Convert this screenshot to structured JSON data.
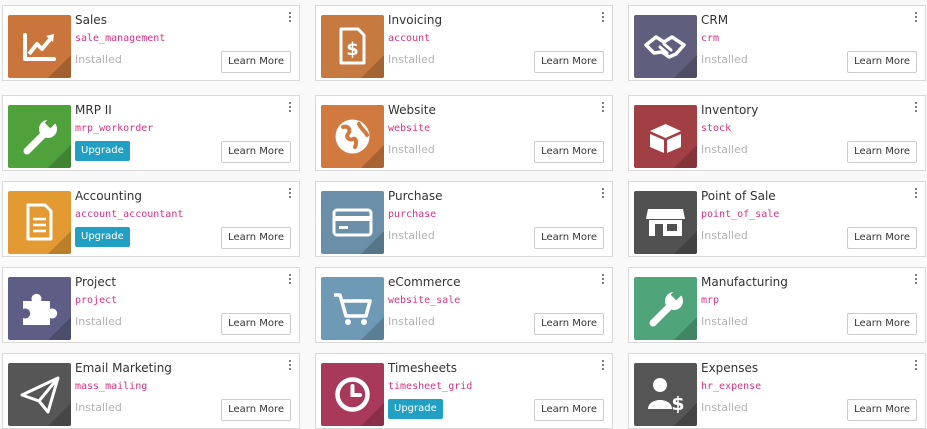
{
  "apps": [
    {
      "name": "Sales",
      "technical": "sale_management",
      "state": "installed",
      "status": "Installed",
      "learn": "Learn More",
      "icon": "sales-chart-icon",
      "color": "#c9753c"
    },
    {
      "name": "Invoicing",
      "technical": "account",
      "state": "installed",
      "status": "Installed",
      "learn": "Learn More",
      "icon": "invoice-dollar-icon",
      "color": "#c77a3f"
    },
    {
      "name": "CRM",
      "technical": "crm",
      "state": "installed",
      "status": "Installed",
      "learn": "Learn More",
      "icon": "handshake-icon",
      "color": "#5f5e7d"
    },
    {
      "name": "MRP II",
      "technical": "mrp_workorder",
      "state": "upgrade",
      "button": "Upgrade",
      "learn": "Learn More",
      "icon": "wrench-icon",
      "color": "#4ea13b"
    },
    {
      "name": "Website",
      "technical": "website",
      "state": "installed",
      "status": "Installed",
      "learn": "Learn More",
      "icon": "globe-icon",
      "color": "#d07a40"
    },
    {
      "name": "Inventory",
      "technical": "stock",
      "state": "installed",
      "status": "Installed",
      "learn": "Learn More",
      "icon": "package-box-icon",
      "color": "#a23f45"
    },
    {
      "name": "Accounting",
      "technical": "account_accountant",
      "state": "upgrade",
      "button": "Upgrade",
      "learn": "Learn More",
      "icon": "document-icon",
      "color": "#e49a32"
    },
    {
      "name": "Purchase",
      "technical": "purchase",
      "state": "installed",
      "status": "Installed",
      "learn": "Learn More",
      "icon": "credit-card-icon",
      "color": "#6b8fa8"
    },
    {
      "name": "Point of Sale",
      "technical": "point_of_sale",
      "state": "installed",
      "status": "Installed",
      "learn": "Learn More",
      "icon": "shop-icon",
      "color": "#515151"
    },
    {
      "name": "Project",
      "technical": "project",
      "state": "installed",
      "status": "Installed",
      "learn": "Learn More",
      "icon": "puzzle-icon",
      "color": "#5d5d86"
    },
    {
      "name": "eCommerce",
      "technical": "website_sale",
      "state": "installed",
      "status": "Installed",
      "learn": "Learn More",
      "icon": "shopping-cart-icon",
      "color": "#6e9ab6"
    },
    {
      "name": "Manufacturing",
      "technical": "mrp",
      "state": "installed",
      "status": "Installed",
      "learn": "Learn More",
      "icon": "wrench-icon",
      "color": "#4fa47a"
    },
    {
      "name": "Email Marketing",
      "technical": "mass_mailing",
      "state": "installed",
      "status": "Installed",
      "learn": "Learn More",
      "icon": "paper-plane-icon",
      "color": "#565656"
    },
    {
      "name": "Timesheets",
      "technical": "timesheet_grid",
      "state": "upgrade",
      "button": "Upgrade",
      "learn": "Learn More",
      "icon": "clock-icon",
      "color": "#a9395b"
    },
    {
      "name": "Expenses",
      "technical": "hr_expense",
      "state": "installed",
      "status": "Installed",
      "learn": "Learn More",
      "icon": "user-dollar-icon",
      "color": "#555555"
    }
  ]
}
